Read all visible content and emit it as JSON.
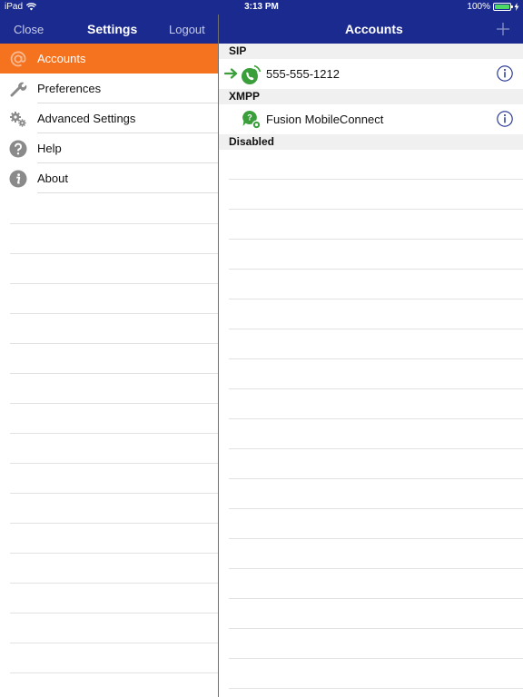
{
  "status_bar": {
    "device": "iPad",
    "time": "3:13 PM",
    "battery": "100%"
  },
  "colors": {
    "nav_bg": "#1a2a8f",
    "selected": "#f5721f",
    "status_green": "#3a9f3a"
  },
  "left_nav": {
    "close": "Close",
    "title": "Settings",
    "logout": "Logout"
  },
  "menu": [
    {
      "label": "Accounts",
      "icon": "at-sign-icon",
      "selected": true
    },
    {
      "label": "Preferences",
      "icon": "wrench-icon"
    },
    {
      "label": "Advanced Settings",
      "icon": "gears-icon"
    },
    {
      "label": "Help",
      "icon": "question-icon"
    },
    {
      "label": "About",
      "icon": "info-circle-icon"
    }
  ],
  "right_nav": {
    "title": "Accounts",
    "add_icon": "plus-icon"
  },
  "sections": {
    "sip": {
      "header": "SIP",
      "accounts": [
        {
          "label": "555-555-1212",
          "default": true,
          "icon": "sip-phone-icon"
        }
      ]
    },
    "xmpp": {
      "header": "XMPP",
      "accounts": [
        {
          "label": "Fusion MobileConnect",
          "icon": "chat-bubble-icon"
        }
      ]
    },
    "disabled": {
      "header": "Disabled"
    }
  }
}
